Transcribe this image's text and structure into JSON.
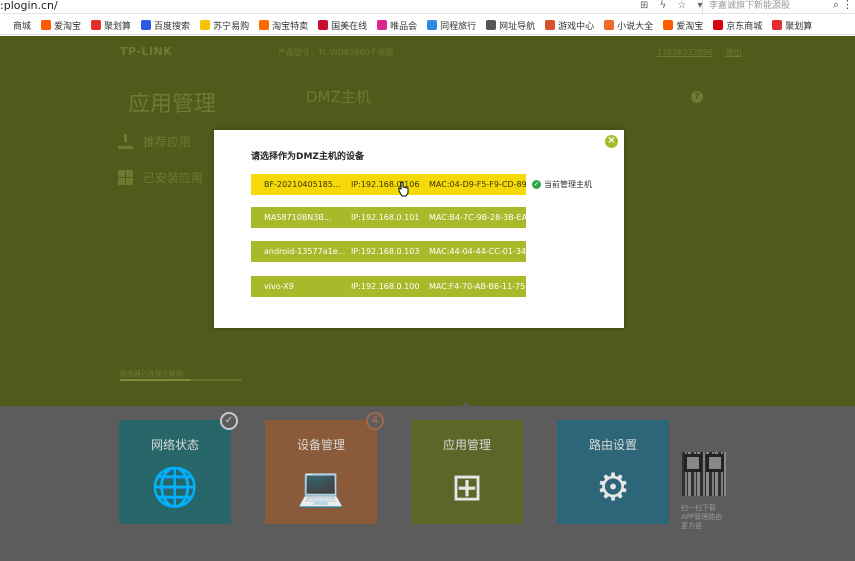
{
  "browser": {
    "url": ":plogin.cn/",
    "search_placeholder": "李嘉诚旗下新能源股",
    "bookmarks": [
      {
        "label": "商城",
        "color": "#ffffff"
      },
      {
        "label": "爱淘宝",
        "color": "#ff5a00"
      },
      {
        "label": "聚划算",
        "color": "#e62e2e"
      },
      {
        "label": "百度搜索",
        "color": "#2d5be3"
      },
      {
        "label": "苏宁易购",
        "color": "#f7c200"
      },
      {
        "label": "淘宝特卖",
        "color": "#ff6a00"
      },
      {
        "label": "国美在线",
        "color": "#c8102e"
      },
      {
        "label": "唯品会",
        "color": "#d9268c"
      },
      {
        "label": "同程旅行",
        "color": "#2d8ce3"
      },
      {
        "label": "网址导航",
        "color": "#555555"
      },
      {
        "label": "游戏中心",
        "color": "#d9522b"
      },
      {
        "label": "小说大全",
        "color": "#f06a2a"
      },
      {
        "label": "爱淘宝",
        "color": "#ff5a00"
      },
      {
        "label": "京东商城",
        "color": "#d6000f"
      },
      {
        "label": "聚划算",
        "color": "#e62e2e"
      }
    ]
  },
  "router": {
    "logo": "TP-LINK",
    "model": "产品型号：TL-WDR5600千兆版",
    "header_links": [
      "13858332896",
      "退出"
    ],
    "app_title": "应用管理",
    "section_title": "DMZ主机",
    "help_label": "?",
    "sidebar": [
      {
        "label": "推荐应用"
      },
      {
        "label": "已安装应用"
      }
    ],
    "progress_label": "路由器已连接互联网",
    "progress": 0.58,
    "tiles": [
      {
        "label": "网络状态",
        "icon": "globe-icon",
        "glyph": "🌐",
        "color": "#27676a"
      },
      {
        "label": "设备管理",
        "icon": "laptop-icon",
        "glyph": "💻",
        "color": "#8a5a3a"
      },
      {
        "label": "应用管理",
        "icon": "apps-icon",
        "glyph": "⊞",
        "color": "#5e6528"
      },
      {
        "label": "路由设置",
        "icon": "gear-icon",
        "glyph": "⚙",
        "color": "#2d6678"
      }
    ],
    "badges": {
      "network": "✓",
      "devices": "4"
    },
    "qr_text": "扫一扫下载 APP管理路由 更方便"
  },
  "modal": {
    "title": "请选择作为DMZ主机的设备",
    "close_label": "×",
    "current_host_label": "当前管理主机",
    "accent": "#a8ba2a",
    "selected_color": "#f5d90a",
    "devices": [
      {
        "name": "BF-20210405185...",
        "ip": "IP:192.168.0.106",
        "mac": "MAC:04-D9-F5-F9-CD-89"
      },
      {
        "name": "MAS8710BN3B...",
        "ip": "IP:192.168.0.101",
        "mac": "MAC:B4-7C-9B-28-3B-EA"
      },
      {
        "name": "android-13577a1e...",
        "ip": "IP:192.168.0.103",
        "mac": "MAC:44-04-44-CC-01-34"
      },
      {
        "name": "vivo-X9",
        "ip": "IP:192.168.0.100",
        "mac": "MAC:F4-70-AB-B6-11-75"
      }
    ]
  }
}
